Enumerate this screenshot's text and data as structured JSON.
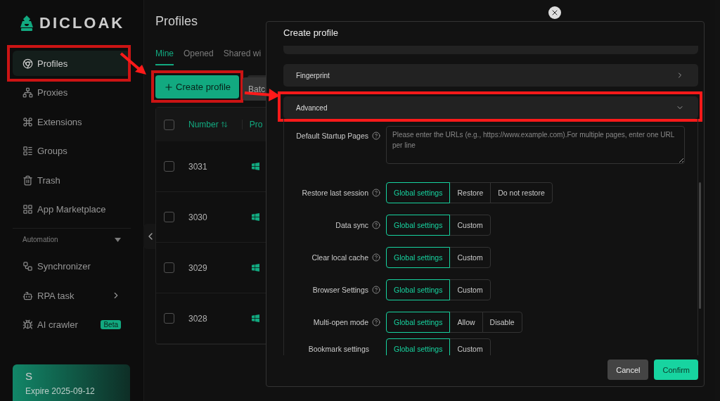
{
  "sidebar": {
    "logo": "DICLOAK",
    "items": [
      {
        "label": "Profiles",
        "selected": true,
        "highlighted": true
      },
      {
        "label": "Proxies",
        "selected": false,
        "highlighted": false
      },
      {
        "label": "Extensions",
        "selected": false,
        "highlighted": false
      },
      {
        "label": "Groups",
        "selected": false,
        "highlighted": false
      },
      {
        "label": "Trash",
        "selected": false,
        "highlighted": false
      },
      {
        "label": "App Marketplace",
        "selected": false,
        "highlighted": false
      }
    ],
    "section": {
      "label": "Automation",
      "expanded": true
    },
    "automation_items": [
      {
        "label": "Synchronizer"
      },
      {
        "label": "RPA task",
        "has_submenu": true
      },
      {
        "label": "AI crawler",
        "badge": "Beta"
      }
    ],
    "plan": {
      "letter": "S",
      "expiry": "Expire 2025-09-12"
    }
  },
  "main": {
    "title": "Profiles",
    "tabs": [
      {
        "label": "Mine",
        "selected": true
      },
      {
        "label": "Opened",
        "selected": false
      },
      {
        "label": "Shared wi",
        "selected": false
      }
    ],
    "create_button": {
      "label": "Create profile",
      "highlighted": true
    },
    "batch_button": "Batc",
    "table": {
      "columns": [
        "Number",
        "Pro"
      ],
      "all_checked": false,
      "rows": [
        {
          "number": "3031",
          "checked": false
        },
        {
          "number": "3030",
          "checked": false
        },
        {
          "number": "3029",
          "checked": false
        },
        {
          "number": "3028",
          "checked": false
        }
      ]
    }
  },
  "dialog": {
    "title": "Create profile",
    "sections": [
      {
        "label": "Fingerprint",
        "expanded": false,
        "highlighted": false
      },
      {
        "label": "Advanced",
        "expanded": true,
        "highlighted": true
      }
    ],
    "fields": [
      {
        "kind": "textarea",
        "label": "Default Startup Pages",
        "help": true,
        "placeholder": "Please enter the URLs (e.g., https://www.example.com).For multiple pages, enter one URL per line"
      },
      {
        "kind": "segmented",
        "label": "Restore last session",
        "help": true,
        "options": [
          {
            "label": "Global settings",
            "selected": true
          },
          {
            "label": "Restore",
            "selected": false
          },
          {
            "label": "Do not restore",
            "selected": false
          }
        ]
      },
      {
        "kind": "segmented",
        "label": "Data sync",
        "help": true,
        "options": [
          {
            "label": "Global settings",
            "selected": true
          },
          {
            "label": "Custom",
            "selected": false
          }
        ]
      },
      {
        "kind": "segmented",
        "label": "Clear local cache",
        "help": true,
        "options": [
          {
            "label": "Global settings",
            "selected": true
          },
          {
            "label": "Custom",
            "selected": false
          }
        ]
      },
      {
        "kind": "segmented",
        "label": "Browser Settings",
        "help": true,
        "options": [
          {
            "label": "Global settings",
            "selected": true
          },
          {
            "label": "Custom",
            "selected": false
          }
        ]
      },
      {
        "kind": "segmented",
        "label": "Multi-open mode",
        "help": true,
        "options": [
          {
            "label": "Global settings",
            "selected": true
          },
          {
            "label": "Allow",
            "selected": false
          },
          {
            "label": "Disable",
            "selected": false
          }
        ]
      },
      {
        "kind": "segmented",
        "label": "Bookmark settings",
        "help": false,
        "options": [
          {
            "label": "Global settings",
            "selected": true
          },
          {
            "label": "Custom",
            "selected": false
          }
        ]
      }
    ],
    "buttons": [
      {
        "label": "Cancel",
        "kind": "secondary"
      },
      {
        "label": "Confirm",
        "kind": "primary"
      }
    ]
  }
}
